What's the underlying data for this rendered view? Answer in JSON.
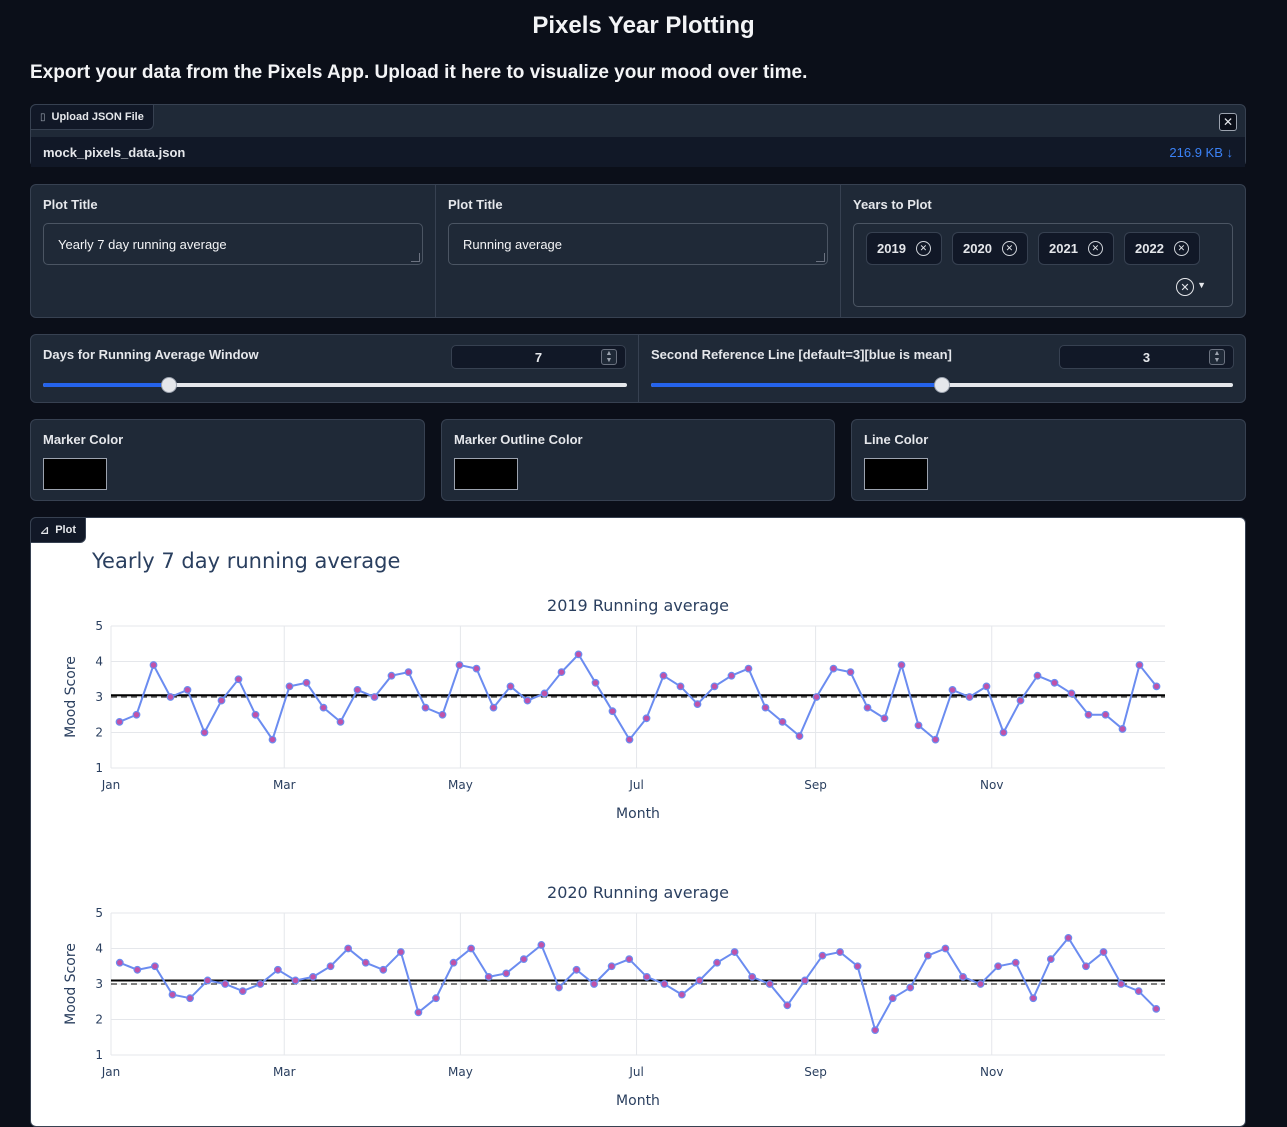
{
  "app": {
    "title": "Pixels Year Plotting",
    "subtitle": "Export your data from the Pixels App. Upload it here to visualize your mood over time."
  },
  "upload": {
    "label": "Upload JSON File",
    "file_name": "mock_pixels_data.json",
    "file_size": "216.9 KB ↓",
    "icon": "file-icon"
  },
  "inputs": {
    "plot_title_label": "Plot Title",
    "plot_title_value": "Yearly 7 day running average",
    "subplot_title_label": "Plot Title",
    "subplot_title_value": "Running average",
    "years_label": "Years to Plot",
    "years": [
      "2019",
      "2020",
      "2021",
      "2022"
    ]
  },
  "sliders": {
    "window_label": "Days for Running Average Window",
    "window_value": "7",
    "window_fraction": 0.215,
    "ref_label": "Second Reference Line [default=3][blue is mean]",
    "ref_value": "3",
    "ref_fraction": 0.5
  },
  "colors": {
    "marker_label": "Marker Color",
    "marker_value": "#000000",
    "outline_label": "Marker Outline Color",
    "outline_value": "#000000",
    "line_label": "Line Color",
    "line_value": "#000000"
  },
  "plot": {
    "tag_label": "Plot",
    "main_title": "Yearly 7 day running average"
  },
  "chart_data": [
    {
      "type": "line",
      "title": "2019 Running average",
      "xlabel": "Month",
      "ylabel": "Mood Score",
      "ylim": [
        1,
        5
      ],
      "x_ticks": [
        "Jan",
        "Mar",
        "May",
        "Jul",
        "Sep",
        "Nov"
      ],
      "y_ticks": [
        1,
        2,
        3,
        4,
        5
      ],
      "reference_lines": {
        "mean": 3.05,
        "second": 3
      },
      "x": [
        3,
        10,
        17,
        24,
        31,
        38,
        45,
        52,
        59,
        66,
        73,
        80,
        87,
        94,
        101,
        108,
        115,
        122,
        129,
        136,
        143,
        150,
        157,
        164,
        171,
        178,
        185,
        192,
        199,
        206,
        213,
        220,
        227,
        234,
        241,
        248,
        255,
        262,
        269,
        276,
        283,
        290,
        297,
        304,
        311,
        318,
        325,
        332,
        339,
        346,
        353,
        360
      ],
      "values": [
        2.3,
        2.5,
        3.9,
        3.0,
        3.2,
        2.0,
        2.9,
        3.5,
        2.5,
        1.8,
        3.3,
        3.4,
        2.7,
        2.3,
        3.2,
        3.0,
        3.6,
        3.7,
        2.7,
        2.5,
        3.9,
        3.8,
        2.7,
        3.3,
        2.9,
        3.1,
        3.7,
        4.2,
        3.4,
        2.6,
        1.8,
        2.4,
        3.6,
        3.3,
        2.8,
        3.3,
        3.6,
        3.8,
        2.7,
        2.3,
        1.9,
        3.0,
        3.8,
        3.7,
        2.7,
        2.4,
        3.9,
        2.2,
        1.8,
        3.2,
        3.0,
        3.3,
        2.0,
        2.9,
        3.6,
        3.4,
        3.1,
        2.5,
        2.5,
        2.1,
        3.9,
        3.3
      ]
    },
    {
      "type": "line",
      "title": "2020 Running average",
      "xlabel": "Month",
      "ylabel": "Mood Score",
      "ylim": [
        1,
        5
      ],
      "x_ticks": [
        "Jan",
        "Mar",
        "May",
        "Jul",
        "Sep",
        "Nov"
      ],
      "y_ticks": [
        1,
        2,
        3,
        4,
        5
      ],
      "reference_lines": {
        "mean": 3.1,
        "second": 3
      },
      "x": [
        3,
        10,
        17,
        24,
        31,
        38,
        45,
        52,
        59,
        66,
        73,
        80,
        87,
        94,
        101,
        108,
        115,
        122,
        129,
        136,
        143,
        150,
        157,
        164,
        171,
        178,
        185,
        192,
        199,
        206,
        213,
        220,
        227,
        234,
        241,
        248,
        255,
        262,
        269,
        276,
        283,
        290,
        297,
        304,
        311,
        318,
        325,
        332,
        339,
        346,
        353,
        360
      ],
      "values": [
        3.6,
        3.4,
        3.5,
        2.7,
        2.6,
        3.1,
        3.0,
        2.8,
        3.0,
        3.4,
        3.1,
        3.2,
        3.5,
        4.0,
        3.6,
        3.4,
        3.9,
        2.2,
        2.6,
        3.6,
        4.0,
        3.2,
        3.3,
        3.7,
        4.1,
        2.9,
        3.4,
        3.0,
        3.5,
        3.7,
        3.2,
        3.0,
        2.7,
        3.1,
        3.6,
        3.9,
        3.2,
        3.0,
        2.4,
        3.1,
        3.8,
        3.9,
        3.5,
        1.7,
        2.6,
        2.9,
        3.8,
        4.0,
        3.2,
        3.0,
        3.5,
        3.6,
        2.6,
        3.7,
        4.3,
        3.5,
        3.9,
        3.0,
        2.8,
        2.3
      ]
    }
  ]
}
